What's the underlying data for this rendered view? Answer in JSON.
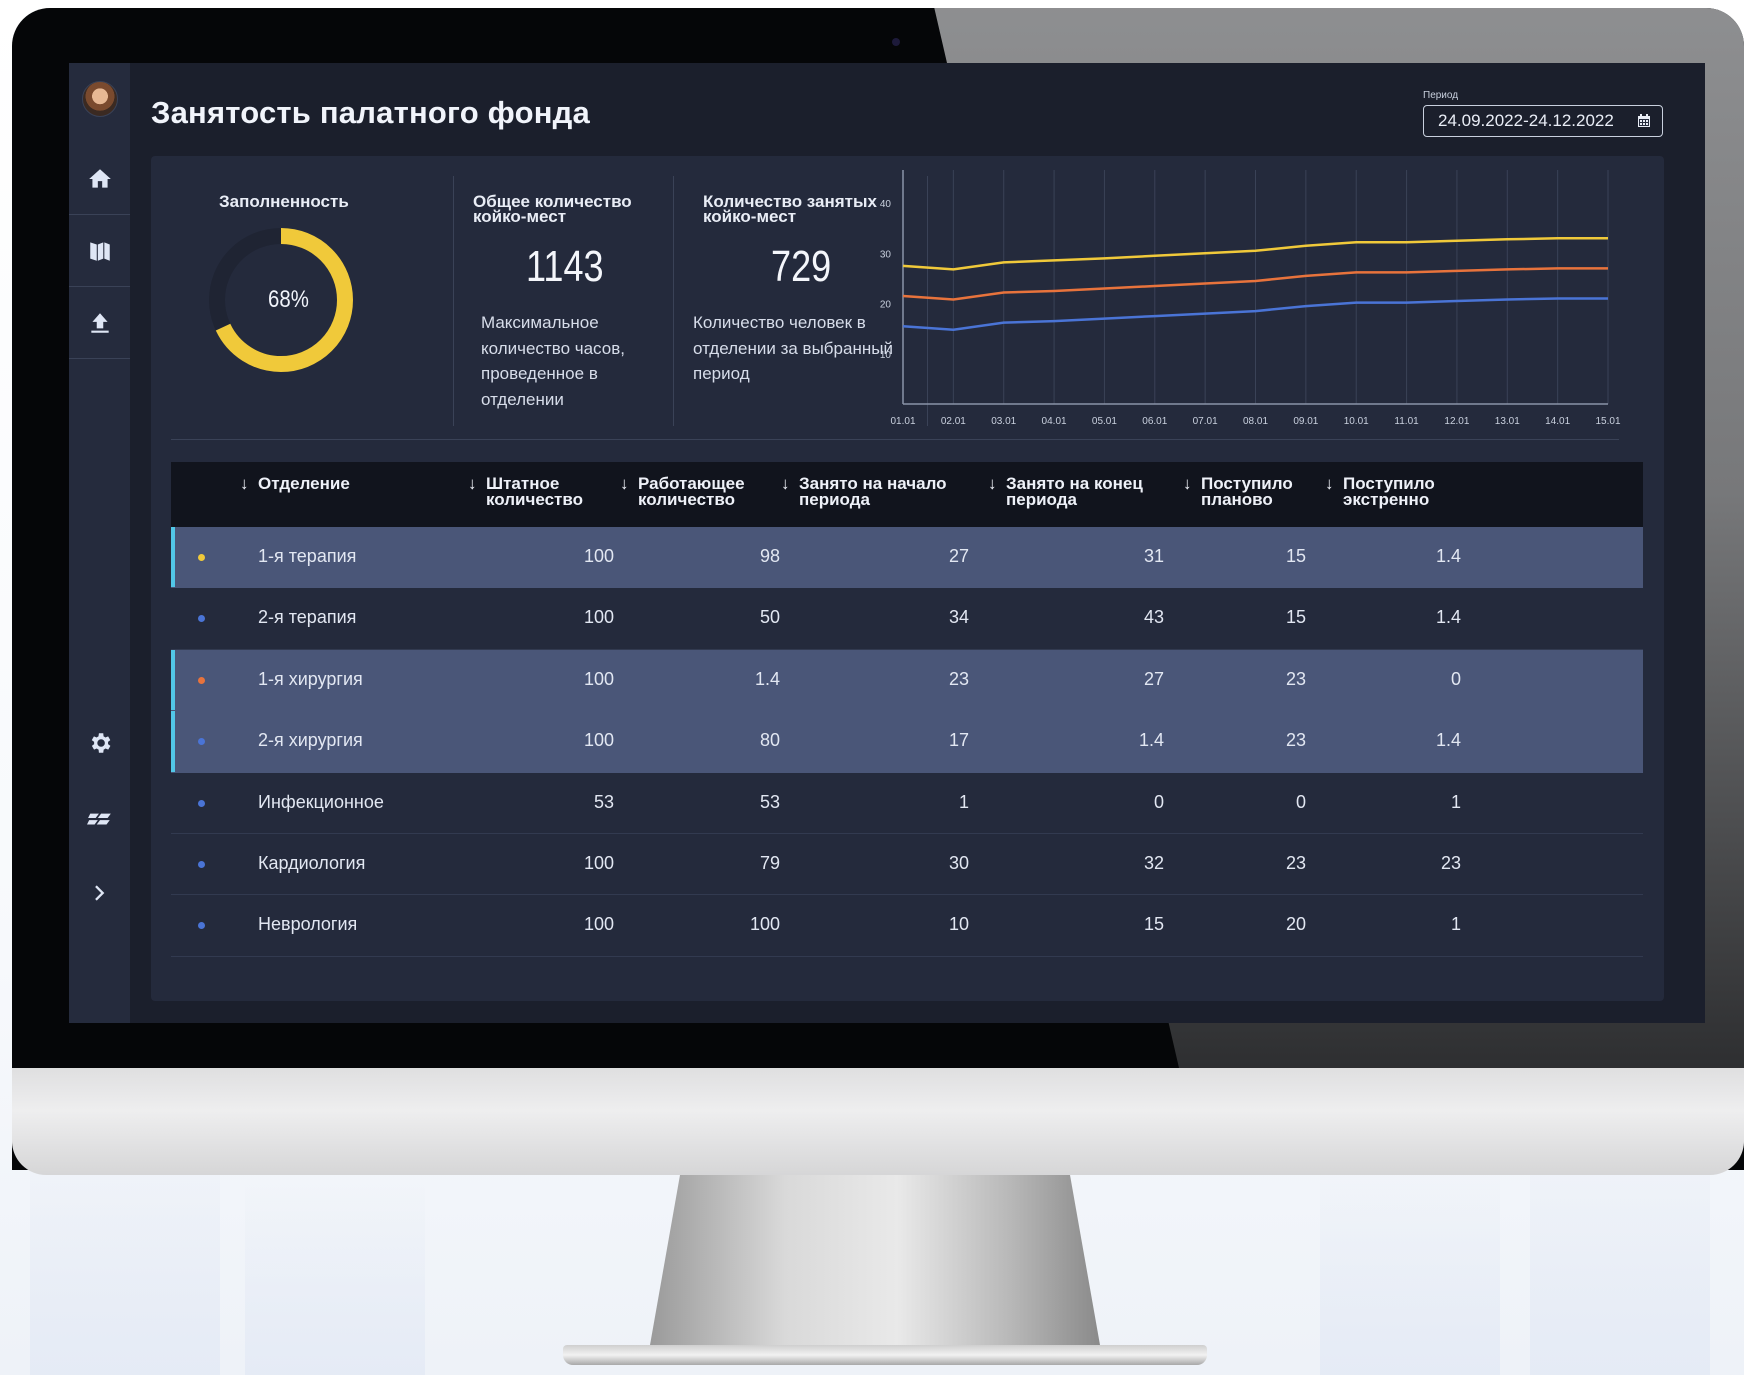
{
  "sidebar": {
    "avatar": "user-avatar",
    "items": [
      {
        "name": "home",
        "icon": "home-icon"
      },
      {
        "name": "map",
        "icon": "map-icon"
      },
      {
        "name": "upload",
        "icon": "upload-icon"
      }
    ],
    "bottom": [
      {
        "name": "settings",
        "icon": "gear-icon"
      },
      {
        "name": "logo",
        "icon": "brand-logo-icon"
      },
      {
        "name": "expand",
        "icon": "chevron-right-icon"
      }
    ]
  },
  "header": {
    "title": "Занятость палатного фонда",
    "period_label": "Период",
    "period_value": "24.09.2022-24.12.2022"
  },
  "kpis": {
    "fill": {
      "title": "Заполненность",
      "percent_label": "68%",
      "percent": 68
    },
    "total": {
      "title": "Общее количество койко-мест",
      "value": "1143",
      "desc": "Максимальное количество часов, проведенное в отделении"
    },
    "occupied": {
      "title": "Количество занятых койко-мест",
      "value": "729",
      "desc": "Количество человек в отделении за выбранный период"
    }
  },
  "chart_data": {
    "type": "line",
    "x": [
      "01.01",
      "02.01",
      "03.01",
      "04.01",
      "05.01",
      "06.01",
      "07.01",
      "08.01",
      "09.01",
      "10.01",
      "11.01",
      "12.01",
      "13.01",
      "14.01",
      "15.01"
    ],
    "ylim": [
      0,
      45
    ],
    "yticks": [
      10,
      20,
      30,
      40
    ],
    "grid": true,
    "series": [
      {
        "color": "#f0c93a",
        "values": [
          27.5,
          26.8,
          28.2,
          28.6,
          29.0,
          29.5,
          30.0,
          30.5,
          31.5,
          32.2,
          32.2,
          32.5,
          32.8,
          33.0,
          33.0
        ]
      },
      {
        "color": "#e8733c",
        "values": [
          21.5,
          20.8,
          22.2,
          22.5,
          23.0,
          23.5,
          24.0,
          24.5,
          25.5,
          26.2,
          26.2,
          26.5,
          26.8,
          27.0,
          27.0
        ]
      },
      {
        "color": "#4a74d6",
        "values": [
          15.5,
          14.8,
          16.2,
          16.5,
          17.0,
          17.5,
          18.0,
          18.5,
          19.5,
          20.2,
          20.2,
          20.5,
          20.8,
          21.0,
          21.0
        ]
      }
    ]
  },
  "table": {
    "columns": [
      "Отделение",
      "Штатное количество",
      "Работающее количество",
      "Занято на начало периода",
      "Занято на конец периода",
      "Поступило планово",
      "Поступило экстренно"
    ],
    "rows": [
      {
        "dot": "#f0c93a",
        "selected": true,
        "cells": [
          "1-я терапия",
          "100",
          "98",
          "27",
          "31",
          "15",
          "1.4"
        ]
      },
      {
        "dot": "#4a74d6",
        "selected": false,
        "cells": [
          "2-я терапия",
          "100",
          "50",
          "34",
          "43",
          "15",
          "1.4"
        ]
      },
      {
        "dot": "#e8733c",
        "selected": true,
        "cells": [
          "1-я хирургия",
          "100",
          "1.4",
          "23",
          "27",
          "23",
          "0"
        ]
      },
      {
        "dot": "#4a74d6",
        "selected": true,
        "cells": [
          "2-я хирургия",
          "100",
          "80",
          "17",
          "1.4",
          "23",
          "1.4"
        ]
      },
      {
        "dot": "#4a74d6",
        "selected": false,
        "cells": [
          "Инфекционное",
          "53",
          "53",
          "1",
          "0",
          "0",
          "1"
        ]
      },
      {
        "dot": "#4a74d6",
        "selected": false,
        "cells": [
          "Кардиология",
          "100",
          "79",
          "30",
          "32",
          "23",
          "23"
        ]
      },
      {
        "dot": "#4a74d6",
        "selected": false,
        "cells": [
          "Неврология",
          "100",
          "100",
          "10",
          "15",
          "20",
          "1"
        ]
      }
    ]
  },
  "colors": {
    "accent": "#f0c93a",
    "selection_bar": "#52c7e8",
    "selected_row": "#4a5678"
  }
}
